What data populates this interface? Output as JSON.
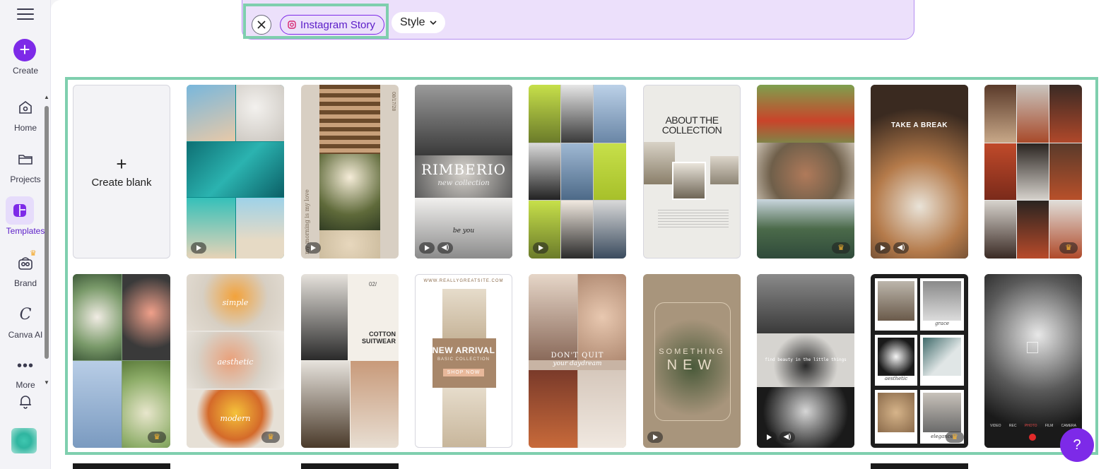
{
  "sidebar": {
    "create_label": "Create",
    "items": [
      {
        "label": "Home",
        "icon": "home-icon"
      },
      {
        "label": "Projects",
        "icon": "folder-icon"
      },
      {
        "label": "Templates",
        "icon": "templates-icon"
      },
      {
        "label": "Brand",
        "icon": "brand-icon"
      },
      {
        "label": "Canva AI",
        "icon": "canva-ai-icon"
      },
      {
        "label": "More",
        "icon": "more-icon"
      }
    ]
  },
  "filters": {
    "chip_label": "Instagram Story",
    "style_label": "Style"
  },
  "templates": {
    "create_blank_label": "Create blank",
    "cards": [
      {
        "title": "ABOUT THE COLLECTION"
      },
      {
        "title": "RIMBERIO",
        "subtitle": "new collection",
        "caption": "be you"
      },
      {
        "title": "TAKE A BREAK"
      },
      {
        "title": "COTTON SUITWEAR"
      },
      {
        "title": "NEW ARRIVAL",
        "subtitle": "BASIC COLLECTION",
        "button": "SHOP NOW",
        "url": "WWW.REALLYGREATSITE.COM"
      },
      {
        "title": "SOMETHING",
        "subtitle": "NEW"
      },
      {
        "title": "find beauty in the little things"
      },
      {
        "words": [
          "simple",
          "aesthetic",
          "modern"
        ]
      },
      {
        "words": [
          "grace",
          "aesthetic",
          "elegance"
        ]
      },
      {
        "title": "DON'T QUIT",
        "subtitle": "your daydream"
      },
      {
        "vertical_text": "my morning is my love",
        "date": "08/17/28"
      }
    ]
  },
  "help_label": "?"
}
